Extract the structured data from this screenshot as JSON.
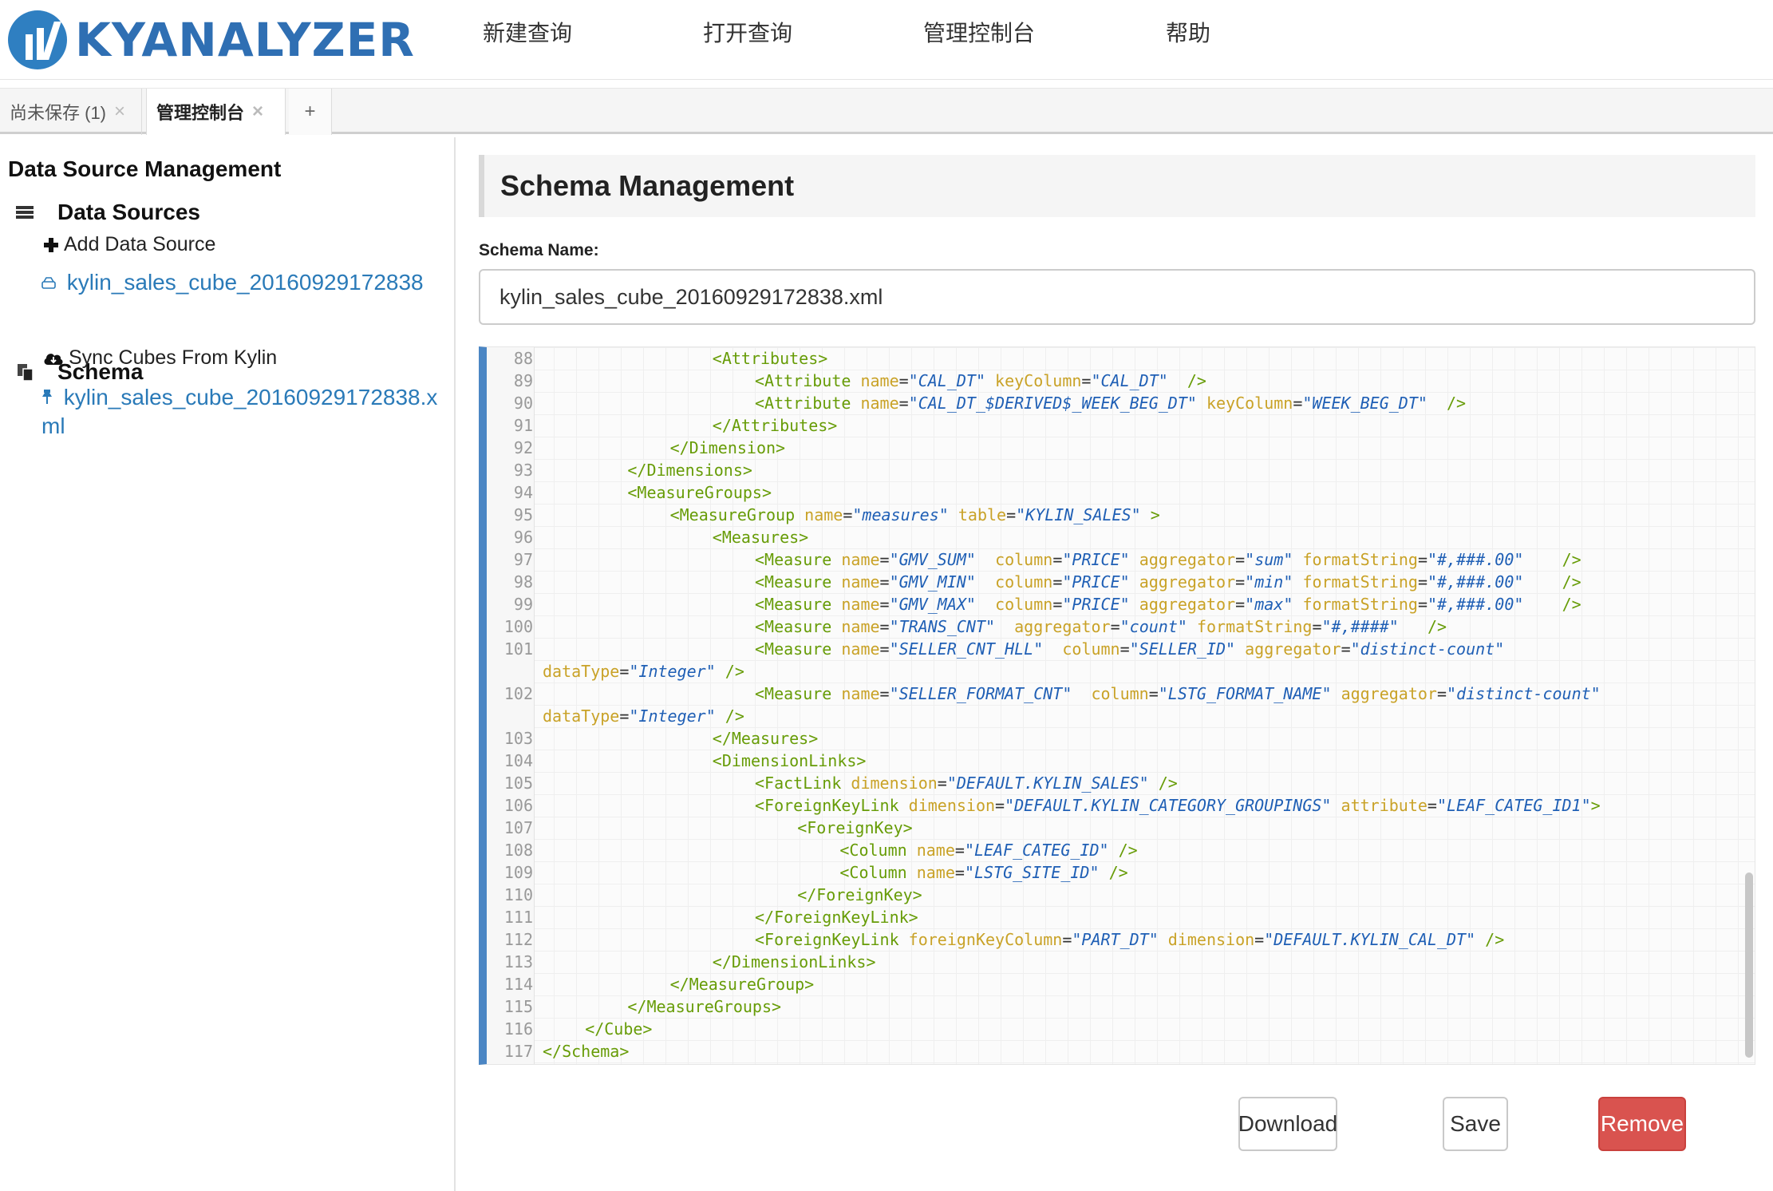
{
  "app": {
    "logo_text": "KYANALYZER",
    "brand_color": "#2f6fb3"
  },
  "nav": {
    "items": [
      "新建查询",
      "打开查询",
      "管理控制台",
      "帮助"
    ]
  },
  "tabs": {
    "items": [
      {
        "label": "尚未保存 (1)",
        "closable": true,
        "active": false
      },
      {
        "label": "管理控制台",
        "closable": true,
        "active": true
      }
    ],
    "add_label": "+"
  },
  "sidebar": {
    "title": "Data Source Management",
    "data_sources": {
      "label": "Data Sources",
      "icon": "list-icon",
      "add_label": "Add Data Source",
      "items": [
        "kylin_sales_cube_20160929172838"
      ]
    },
    "schema": {
      "label": "Schema",
      "icon": "copy-icon",
      "sync_label": "Sync Cubes From Kylin",
      "items": [
        "kylin_sales_cube_20160929172838.xml"
      ]
    }
  },
  "main": {
    "header": "Schema Management",
    "schema_name_label": "Schema Name:",
    "schema_name_value": "kylin_sales_cube_20160929172838.xml",
    "buttons": {
      "download": "Download",
      "save": "Save",
      "remove": "Remove"
    },
    "accent_danger": "#d9534f",
    "editor_accent": "#4b86c4"
  },
  "editor": {
    "lines": [
      {
        "n": "88",
        "ind": 8,
        "segs": [
          {
            "t": "t",
            "x": "<Attributes>"
          }
        ]
      },
      {
        "n": "89",
        "ind": 10,
        "segs": [
          {
            "t": "t",
            "x": "<Attribute "
          },
          {
            "t": "a",
            "x": "name"
          },
          {
            "t": "p",
            "x": "="
          },
          {
            "t": "v",
            "x": "\"CAL_DT\""
          },
          {
            "t": "p",
            "x": " "
          },
          {
            "t": "a",
            "x": "keyColumn"
          },
          {
            "t": "p",
            "x": "="
          },
          {
            "t": "v",
            "x": "\"CAL_DT\""
          },
          {
            "t": "p",
            "x": "  "
          },
          {
            "t": "t",
            "x": "/>"
          }
        ]
      },
      {
        "n": "90",
        "ind": 10,
        "segs": [
          {
            "t": "t",
            "x": "<Attribute "
          },
          {
            "t": "a",
            "x": "name"
          },
          {
            "t": "p",
            "x": "="
          },
          {
            "t": "v",
            "x": "\"CAL_DT_$DERIVED$_WEEK_BEG_DT\""
          },
          {
            "t": "p",
            "x": " "
          },
          {
            "t": "a",
            "x": "keyColumn"
          },
          {
            "t": "p",
            "x": "="
          },
          {
            "t": "v",
            "x": "\"WEEK_BEG_DT\""
          },
          {
            "t": "p",
            "x": "  "
          },
          {
            "t": "t",
            "x": "/>"
          }
        ]
      },
      {
        "n": "91",
        "ind": 8,
        "segs": [
          {
            "t": "t",
            "x": "</Attributes>"
          }
        ]
      },
      {
        "n": "92",
        "ind": 6,
        "segs": [
          {
            "t": "t",
            "x": "</Dimension>"
          }
        ]
      },
      {
        "n": "93",
        "ind": 4,
        "segs": [
          {
            "t": "t",
            "x": "</Dimensions>"
          }
        ]
      },
      {
        "n": "94",
        "ind": 4,
        "segs": [
          {
            "t": "t",
            "x": "<MeasureGroups>"
          }
        ]
      },
      {
        "n": "95",
        "ind": 6,
        "segs": [
          {
            "t": "t",
            "x": "<MeasureGroup "
          },
          {
            "t": "a",
            "x": "name"
          },
          {
            "t": "p",
            "x": "="
          },
          {
            "t": "v",
            "x": "\"measures\""
          },
          {
            "t": "p",
            "x": " "
          },
          {
            "t": "a",
            "x": "table"
          },
          {
            "t": "p",
            "x": "="
          },
          {
            "t": "v",
            "x": "\"KYLIN_SALES\""
          },
          {
            "t": "p",
            "x": " "
          },
          {
            "t": "t",
            "x": ">"
          }
        ]
      },
      {
        "n": "96",
        "ind": 8,
        "segs": [
          {
            "t": "t",
            "x": "<Measures>"
          }
        ]
      },
      {
        "n": "97",
        "ind": 10,
        "segs": [
          {
            "t": "t",
            "x": "<Measure "
          },
          {
            "t": "a",
            "x": "name"
          },
          {
            "t": "p",
            "x": "="
          },
          {
            "t": "v",
            "x": "\"GMV_SUM\""
          },
          {
            "t": "p",
            "x": "  "
          },
          {
            "t": "a",
            "x": "column"
          },
          {
            "t": "p",
            "x": "="
          },
          {
            "t": "v",
            "x": "\"PRICE\""
          },
          {
            "t": "p",
            "x": " "
          },
          {
            "t": "a",
            "x": "aggregator"
          },
          {
            "t": "p",
            "x": "="
          },
          {
            "t": "v",
            "x": "\"sum\""
          },
          {
            "t": "p",
            "x": " "
          },
          {
            "t": "a",
            "x": "formatString"
          },
          {
            "t": "p",
            "x": "="
          },
          {
            "t": "v",
            "x": "\"#,###.00\""
          },
          {
            "t": "p",
            "x": "    "
          },
          {
            "t": "t",
            "x": "/>"
          }
        ]
      },
      {
        "n": "98",
        "ind": 10,
        "segs": [
          {
            "t": "t",
            "x": "<Measure "
          },
          {
            "t": "a",
            "x": "name"
          },
          {
            "t": "p",
            "x": "="
          },
          {
            "t": "v",
            "x": "\"GMV_MIN\""
          },
          {
            "t": "p",
            "x": "  "
          },
          {
            "t": "a",
            "x": "column"
          },
          {
            "t": "p",
            "x": "="
          },
          {
            "t": "v",
            "x": "\"PRICE\""
          },
          {
            "t": "p",
            "x": " "
          },
          {
            "t": "a",
            "x": "aggregator"
          },
          {
            "t": "p",
            "x": "="
          },
          {
            "t": "v",
            "x": "\"min\""
          },
          {
            "t": "p",
            "x": " "
          },
          {
            "t": "a",
            "x": "formatString"
          },
          {
            "t": "p",
            "x": "="
          },
          {
            "t": "v",
            "x": "\"#,###.00\""
          },
          {
            "t": "p",
            "x": "    "
          },
          {
            "t": "t",
            "x": "/>"
          }
        ]
      },
      {
        "n": "99",
        "ind": 10,
        "segs": [
          {
            "t": "t",
            "x": "<Measure "
          },
          {
            "t": "a",
            "x": "name"
          },
          {
            "t": "p",
            "x": "="
          },
          {
            "t": "v",
            "x": "\"GMV_MAX\""
          },
          {
            "t": "p",
            "x": "  "
          },
          {
            "t": "a",
            "x": "column"
          },
          {
            "t": "p",
            "x": "="
          },
          {
            "t": "v",
            "x": "\"PRICE\""
          },
          {
            "t": "p",
            "x": " "
          },
          {
            "t": "a",
            "x": "aggregator"
          },
          {
            "t": "p",
            "x": "="
          },
          {
            "t": "v",
            "x": "\"max\""
          },
          {
            "t": "p",
            "x": " "
          },
          {
            "t": "a",
            "x": "formatString"
          },
          {
            "t": "p",
            "x": "="
          },
          {
            "t": "v",
            "x": "\"#,###.00\""
          },
          {
            "t": "p",
            "x": "    "
          },
          {
            "t": "t",
            "x": "/>"
          }
        ]
      },
      {
        "n": "100",
        "ind": 10,
        "segs": [
          {
            "t": "t",
            "x": "<Measure "
          },
          {
            "t": "a",
            "x": "name"
          },
          {
            "t": "p",
            "x": "="
          },
          {
            "t": "v",
            "x": "\"TRANS_CNT\""
          },
          {
            "t": "p",
            "x": "  "
          },
          {
            "t": "a",
            "x": "aggregator"
          },
          {
            "t": "p",
            "x": "="
          },
          {
            "t": "v",
            "x": "\"count\""
          },
          {
            "t": "p",
            "x": " "
          },
          {
            "t": "a",
            "x": "formatString"
          },
          {
            "t": "p",
            "x": "="
          },
          {
            "t": "v",
            "x": "\"#,####\""
          },
          {
            "t": "p",
            "x": "   "
          },
          {
            "t": "t",
            "x": "/>"
          }
        ]
      },
      {
        "n": "101",
        "ind": 10,
        "segs": [
          {
            "t": "t",
            "x": "<Measure "
          },
          {
            "t": "a",
            "x": "name"
          },
          {
            "t": "p",
            "x": "="
          },
          {
            "t": "v",
            "x": "\"SELLER_CNT_HLL\""
          },
          {
            "t": "p",
            "x": "  "
          },
          {
            "t": "a",
            "x": "column"
          },
          {
            "t": "p",
            "x": "="
          },
          {
            "t": "v",
            "x": "\"SELLER_ID\""
          },
          {
            "t": "p",
            "x": " "
          },
          {
            "t": "a",
            "x": "aggregator"
          },
          {
            "t": "p",
            "x": "="
          },
          {
            "t": "v",
            "x": "\"distinct-count\""
          }
        ]
      },
      {
        "n": "",
        "ind": 0,
        "segs": [
          {
            "t": "a",
            "x": "dataType"
          },
          {
            "t": "p",
            "x": "="
          },
          {
            "t": "v",
            "x": "\"Integer\""
          },
          {
            "t": "p",
            "x": " "
          },
          {
            "t": "t",
            "x": "/>"
          }
        ]
      },
      {
        "n": "102",
        "ind": 10,
        "segs": [
          {
            "t": "t",
            "x": "<Measure "
          },
          {
            "t": "a",
            "x": "name"
          },
          {
            "t": "p",
            "x": "="
          },
          {
            "t": "v",
            "x": "\"SELLER_FORMAT_CNT\""
          },
          {
            "t": "p",
            "x": "  "
          },
          {
            "t": "a",
            "x": "column"
          },
          {
            "t": "p",
            "x": "="
          },
          {
            "t": "v",
            "x": "\"LSTG_FORMAT_NAME\""
          },
          {
            "t": "p",
            "x": " "
          },
          {
            "t": "a",
            "x": "aggregator"
          },
          {
            "t": "p",
            "x": "="
          },
          {
            "t": "v",
            "x": "\"distinct-count\""
          }
        ]
      },
      {
        "n": "",
        "ind": 0,
        "segs": [
          {
            "t": "a",
            "x": "dataType"
          },
          {
            "t": "p",
            "x": "="
          },
          {
            "t": "v",
            "x": "\"Integer\""
          },
          {
            "t": "p",
            "x": " "
          },
          {
            "t": "t",
            "x": "/>"
          }
        ]
      },
      {
        "n": "103",
        "ind": 8,
        "segs": [
          {
            "t": "t",
            "x": "</Measures>"
          }
        ]
      },
      {
        "n": "104",
        "ind": 8,
        "segs": [
          {
            "t": "t",
            "x": "<DimensionLinks>"
          }
        ]
      },
      {
        "n": "105",
        "ind": 10,
        "segs": [
          {
            "t": "t",
            "x": "<FactLink "
          },
          {
            "t": "a",
            "x": "dimension"
          },
          {
            "t": "p",
            "x": "="
          },
          {
            "t": "v",
            "x": "\"DEFAULT.KYLIN_SALES\""
          },
          {
            "t": "p",
            "x": " "
          },
          {
            "t": "t",
            "x": "/>"
          }
        ]
      },
      {
        "n": "106",
        "ind": 10,
        "segs": [
          {
            "t": "t",
            "x": "<ForeignKeyLink "
          },
          {
            "t": "a",
            "x": "dimension"
          },
          {
            "t": "p",
            "x": "="
          },
          {
            "t": "v",
            "x": "\"DEFAULT.KYLIN_CATEGORY_GROUPINGS\""
          },
          {
            "t": "p",
            "x": " "
          },
          {
            "t": "a",
            "x": "attribute"
          },
          {
            "t": "p",
            "x": "="
          },
          {
            "t": "v",
            "x": "\"LEAF_CATEG_ID1\""
          },
          {
            "t": "t",
            "x": ">"
          }
        ]
      },
      {
        "n": "107",
        "ind": 12,
        "segs": [
          {
            "t": "t",
            "x": "<ForeignKey>"
          }
        ]
      },
      {
        "n": "108",
        "ind": 14,
        "segs": [
          {
            "t": "t",
            "x": "<Column "
          },
          {
            "t": "a",
            "x": "name"
          },
          {
            "t": "p",
            "x": "="
          },
          {
            "t": "v",
            "x": "\"LEAF_CATEG_ID\""
          },
          {
            "t": "p",
            "x": " "
          },
          {
            "t": "t",
            "x": "/>"
          }
        ]
      },
      {
        "n": "109",
        "ind": 14,
        "segs": [
          {
            "t": "t",
            "x": "<Column "
          },
          {
            "t": "a",
            "x": "name"
          },
          {
            "t": "p",
            "x": "="
          },
          {
            "t": "v",
            "x": "\"LSTG_SITE_ID\""
          },
          {
            "t": "p",
            "x": " "
          },
          {
            "t": "t",
            "x": "/>"
          }
        ]
      },
      {
        "n": "110",
        "ind": 12,
        "segs": [
          {
            "t": "t",
            "x": "</ForeignKey>"
          }
        ]
      },
      {
        "n": "111",
        "ind": 10,
        "segs": [
          {
            "t": "t",
            "x": "</ForeignKeyLink>"
          }
        ]
      },
      {
        "n": "112",
        "ind": 10,
        "segs": [
          {
            "t": "t",
            "x": "<ForeignKeyLink "
          },
          {
            "t": "a",
            "x": "foreignKeyColumn"
          },
          {
            "t": "p",
            "x": "="
          },
          {
            "t": "v",
            "x": "\"PART_DT\""
          },
          {
            "t": "p",
            "x": " "
          },
          {
            "t": "a",
            "x": "dimension"
          },
          {
            "t": "p",
            "x": "="
          },
          {
            "t": "v",
            "x": "\"DEFAULT.KYLIN_CAL_DT\""
          },
          {
            "t": "p",
            "x": " "
          },
          {
            "t": "t",
            "x": "/>"
          }
        ]
      },
      {
        "n": "113",
        "ind": 8,
        "segs": [
          {
            "t": "t",
            "x": "</DimensionLinks>"
          }
        ]
      },
      {
        "n": "114",
        "ind": 6,
        "segs": [
          {
            "t": "t",
            "x": "</MeasureGroup>"
          }
        ]
      },
      {
        "n": "115",
        "ind": 4,
        "segs": [
          {
            "t": "t",
            "x": "</MeasureGroups>"
          }
        ]
      },
      {
        "n": "116",
        "ind": 2,
        "segs": [
          {
            "t": "t",
            "x": "</Cube>"
          }
        ]
      },
      {
        "n": "117",
        "ind": 0,
        "segs": [
          {
            "t": "t",
            "x": "</Schema>"
          }
        ]
      }
    ]
  }
}
